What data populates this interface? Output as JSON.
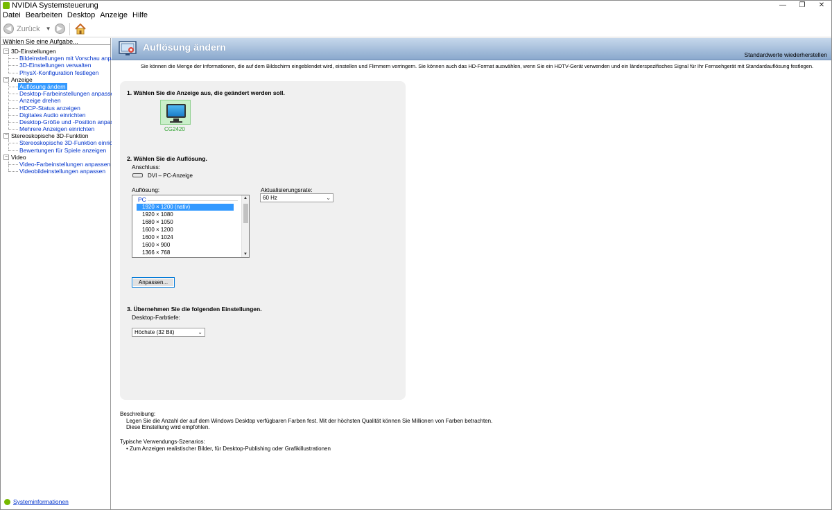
{
  "window": {
    "title": "NVIDIA Systemsteuerung",
    "controls": [
      "—",
      "❐",
      "✕"
    ]
  },
  "menu": [
    "Datei",
    "Bearbeiten",
    "Desktop",
    "Anzeige",
    "Hilfe"
  ],
  "toolbar": {
    "back_label": "Zurück"
  },
  "left": {
    "task_header": "Wählen Sie eine Aufgabe...",
    "categories": [
      {
        "label": "3D-Einstellungen",
        "items": [
          "Bildeinstellungen mit Vorschau anpassen",
          "3D-Einstellungen verwalten",
          "PhysX-Konfiguration festlegen"
        ]
      },
      {
        "label": "Anzeige",
        "items": [
          "Auflösung ändern",
          "Desktop-Farbeinstellungen anpassen",
          "Anzeige drehen",
          "HDCP-Status anzeigen",
          "Digitales Audio einrichten",
          "Desktop-Größe und -Position anpassen",
          "Mehrere Anzeigen einrichten"
        ]
      },
      {
        "label": "Stereoskopische 3D-Funktion",
        "items": [
          "Stereoskopische 3D-Funktion einrichten",
          "Bewertungen für Spiele anzeigen"
        ]
      },
      {
        "label": "Video",
        "items": [
          "Video-Farbeinstellungen anpassen",
          "Videobildeinstellungen anpassen"
        ]
      }
    ],
    "sysinfo": "Systeminformationen"
  },
  "page": {
    "title": "Auflösung ändern",
    "restore": "Standardwerte wiederherstellen",
    "intro": "Sie können die Menge der Informationen, die auf dem Bildschirm eingeblendet wird, einstellen und Flimmern verringern. Sie können auch das HD-Format auswählen, wenn Sie ein HDTV-Gerät verwenden und ein länderspezifisches Signal für Ihr Fernsehgerät mit Standardauflösung festlegen.",
    "step1": "1. Wählen Sie die Anzeige aus, die geändert werden soll.",
    "display_name": "CG2420",
    "step2": "2. Wählen Sie die Auflösung.",
    "connection_label": "Anschluss:",
    "connection": "DVI – PC-Anzeige",
    "resolution_label": "Auflösung:",
    "resolution_group": "PC",
    "resolutions": [
      "1920 × 1200 (nativ)",
      "1920 × 1080",
      "1680 × 1050",
      "1600 × 1200",
      "1600 × 1024",
      "1600 × 900",
      "1366 × 768"
    ],
    "refresh_label": "Aktualisierungsrate:",
    "refresh_value": "60 Hz",
    "customize": "Anpassen...",
    "step3": "3. Übernehmen Sie die folgenden Einstellungen.",
    "depth_label": "Desktop-Farbtiefe:",
    "depth_value": "Höchste (32 Bit)"
  },
  "description": {
    "label": "Beschreibung:",
    "line1": "Legen Sie die Anzahl der auf dem Windows Desktop verfügbaren Farben fest. Mit der höchsten Qualität können Sie Millionen von Farben betrachten.",
    "line2": "Diese Einstellung wird empfohlen."
  },
  "usage": {
    "label": "Typische Verwendungs-Szenarios:",
    "item": "• Zum Anzeigen realistischer Bilder, für Desktop-Publishing oder Grafikillustrationen"
  },
  "colors": {
    "accent": "#76b900",
    "selection": "#3399ff",
    "link": "#0033cc",
    "banner": "#8aa8cd"
  }
}
